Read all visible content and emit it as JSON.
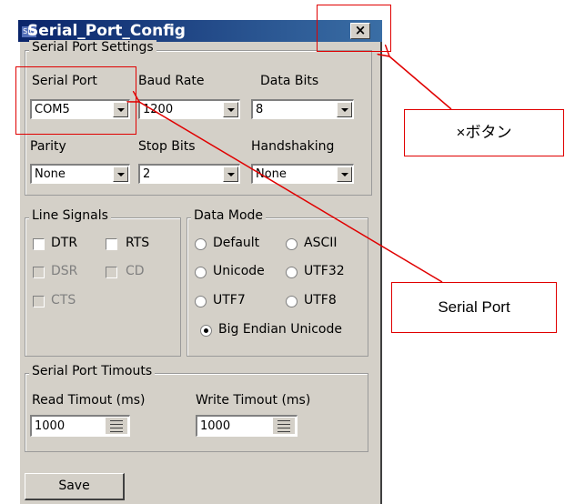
{
  "window": {
    "title": "Serial_Port_Config",
    "icon_text": "SIO",
    "close_label": "×"
  },
  "settings_group": {
    "legend": "Serial Port Settings",
    "serial_port": {
      "label": "Serial Port",
      "value": "COM5"
    },
    "baud_rate": {
      "label": "Baud Rate",
      "value": "1200"
    },
    "data_bits": {
      "label": "Data Bits",
      "value": "8"
    },
    "parity": {
      "label": "Parity",
      "value": "None"
    },
    "stop_bits": {
      "label": "Stop Bits",
      "value": "2"
    },
    "handshaking": {
      "label": "Handshaking",
      "value": "None"
    }
  },
  "line_signals": {
    "legend": "Line Signals",
    "dtr": "DTR",
    "rts": "RTS",
    "dsr": "DSR",
    "cd": "CD",
    "cts": "CTS"
  },
  "data_mode": {
    "legend": "Data Mode",
    "default": "Default",
    "ascii": "ASCII",
    "unicode": "Unicode",
    "utf32": "UTF32",
    "utf7": "UTF7",
    "utf8": "UTF8",
    "big_endian": "Big Endian Unicode",
    "selected": "Big Endian Unicode"
  },
  "timeouts": {
    "legend": "Serial Port Timouts",
    "read_label": "Read Timout (ms)",
    "read_value": "1000",
    "write_label": "Write Timout (ms)",
    "write_value": "1000"
  },
  "save_label": "Save",
  "annotations": {
    "close_callout": "×ボタン",
    "serial_port_callout": "Serial Port",
    "color": "#e00000"
  }
}
